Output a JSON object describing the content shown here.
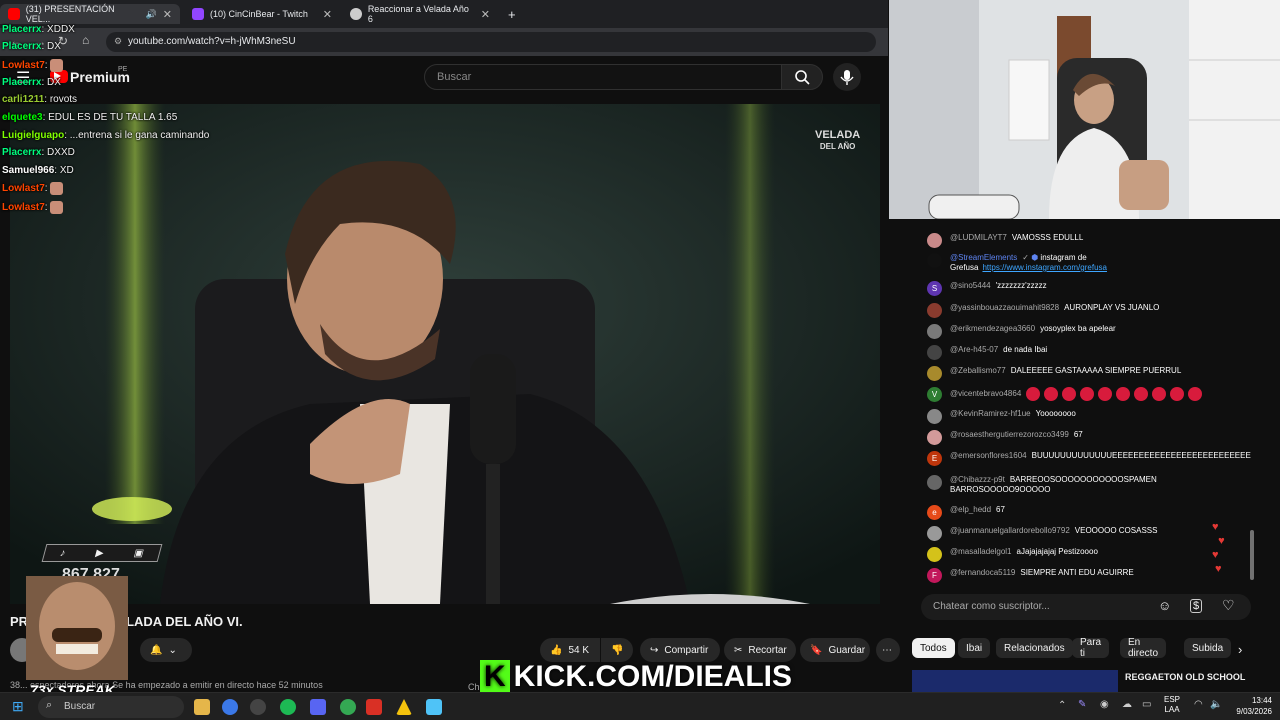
{
  "browser": {
    "tabs": [
      {
        "label": "(31) PRESENTACIÓN VEL...",
        "favicon_color": "#ff0000",
        "active": true
      },
      {
        "label": "(10) CinCinBear - Twitch",
        "favicon_color": "#9146ff",
        "active": false
      },
      {
        "label": "Reaccionar a Velada Año 6",
        "favicon_color": "#cccccc",
        "active": false
      }
    ],
    "new_tab": "+",
    "url": "youtube.com/watch?v=h-jWhM3neSU"
  },
  "youtube": {
    "brand": "Premium",
    "region": "PE",
    "search_placeholder": "Buscar",
    "video_watermark_line1": "VELADA",
    "video_watermark_line2": "DEL AÑO",
    "overlay_counter": "867.827",
    "title_start": "PR",
    "title_end": "LADA DEL AÑO VI.",
    "likes": "54 K",
    "share_label": "Compartir",
    "clip_label": "Recortar",
    "save_label": "Guardar",
    "description": "38... espectadores ahora  Se ha empezado a emitir en directo hace 52 minutos",
    "next_video_left": "Ch",
    "next_video_title": "REGGAETON OLD SCHOOL"
  },
  "live_chat": {
    "messages": [
      {
        "author": "@LUDMILAYT7",
        "text": "VAMOSSS EDULLL",
        "color": "#c98a8a",
        "initial": ""
      },
      {
        "author": "@StreamElements",
        "text": "instagram de Grefusa",
        "link": "https://www.instagram.com/grefusa",
        "color": "#111111",
        "initial": "",
        "mod": true
      },
      {
        "author": "@sino5444",
        "text": "'zzzzzzz'zzzzz",
        "color": "#5e35b1",
        "initial": "S"
      },
      {
        "author": "@yassinbouazzaouimahit9828",
        "text": "AURONPLAY VS JUANLO",
        "color": "#8a3b2e",
        "initial": ""
      },
      {
        "author": "@erikmendezagea3660",
        "text": "yosoyplex ba apelear",
        "color": "#7a7a7a",
        "initial": ""
      },
      {
        "author": "@Are-h45-07",
        "text": "de nada Ibai",
        "color": "#444444",
        "initial": ""
      },
      {
        "author": "@Zeballismo77",
        "text": "DALEEEEE GASTAAAAA SIEMPRE PUERRUL",
        "color": "#a88a2c",
        "initial": ""
      },
      {
        "author": "@vicentebravo4864",
        "text": "",
        "color": "#2e7d32",
        "initial": "V",
        "emotes": 10
      },
      {
        "author": "@KevinRamirez-hf1ue",
        "text": "Yoooooooo",
        "color": "#888888",
        "initial": ""
      },
      {
        "author": "@rosaesthergutierrezorozco3499",
        "text": "67",
        "color": "#d39a9a",
        "initial": ""
      },
      {
        "author": "@emersonflores1604",
        "text": "BUUUUUUUUUUUUUEEEEEEEEEEEEEEEEEEEEEEEEEE",
        "color": "#bf360c",
        "initial": "E"
      },
      {
        "author": "@Chibazzz-p9t",
        "text": "BARREOOSOOOOOOOOOOOSPAMEN BARROSOOOOO9OOOOO",
        "color": "#666666",
        "initial": ""
      },
      {
        "author": "@elp_hedd",
        "text": "67",
        "color": "#e64a19",
        "initial": "e"
      },
      {
        "author": "@juanmanuelgallardorebollo9792",
        "text": "VEOOOOO COSASSS",
        "color": "#999999",
        "initial": ""
      },
      {
        "author": "@masalladelgol1",
        "text": "aJajajajajaj Pestizoooo",
        "color": "#d4c21a",
        "initial": ""
      },
      {
        "author": "@fernandoca5119",
        "text": "SIEMPRE ANTI EDU AGUIRRE",
        "color": "#c2185b",
        "initial": "F"
      }
    ],
    "input_placeholder": "Chatear como suscriptor...",
    "chips": [
      "Todos",
      "Ibai",
      "Relacionados",
      "Para ti",
      "En directo",
      "Subida"
    ]
  },
  "overlay_chat": [
    {
      "user": "Placerrx",
      "msg": "XDDX",
      "color": "#00ff7f"
    },
    {
      "user": "Placerrx",
      "msg": "DX",
      "color": "#00ff7f"
    },
    {
      "user": "Lowlast7",
      "msg": "",
      "color": "#ff4500"
    },
    {
      "user": "Placerrx",
      "msg": "DX",
      "color": "#00ff7f"
    },
    {
      "user": "carli1211",
      "msg": "rovots",
      "color": "#9acd32"
    },
    {
      "user": "elquete3",
      "msg": "EDUL ES DE TU TALLA 1.65",
      "color": "#00ff00"
    },
    {
      "user": "Luigielguapo",
      "msg": "...entrena si le gana caminando",
      "color": "#7fff00"
    },
    {
      "user": "Placerrx",
      "msg": "DXXD",
      "color": "#00ff7f"
    },
    {
      "user": "Samuel966",
      "msg": "XD",
      "color": "#ffffff"
    },
    {
      "user": "Lowlast7",
      "msg": "",
      "color": "#ff4500"
    },
    {
      "user": "Lowlast7",
      "msg": "",
      "color": "#ff4500"
    }
  ],
  "stream_overlay": {
    "streak": "73x STREAK",
    "kick": "KICK.COM/DIEALIS"
  },
  "taskbar": {
    "search": "Buscar",
    "lang1": "ESP",
    "lang2": "LAA",
    "time": "13:44",
    "date": "9/03/2026"
  }
}
